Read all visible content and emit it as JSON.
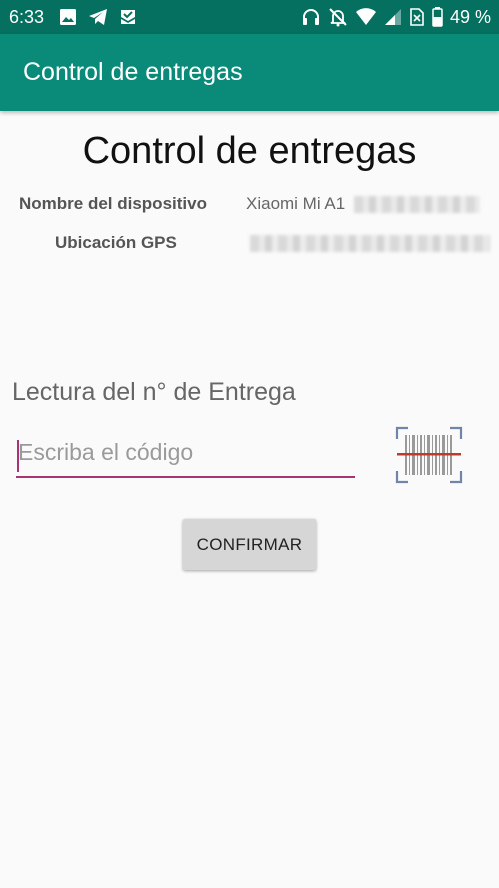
{
  "status_bar": {
    "time": "6:33",
    "battery_percent": "49 %",
    "left_icons": [
      "image-icon",
      "telegram-icon",
      "mail-check-icon"
    ],
    "right_icons": [
      "headphones-icon",
      "bell-off-icon",
      "wifi-icon",
      "cell-signal-icon",
      "no-sim-icon",
      "battery-icon"
    ]
  },
  "app_bar": {
    "title": "Control de entregas"
  },
  "main": {
    "title": "Control de entregas",
    "device_label": "Nombre del dispositivo",
    "device_value": "Xiaomi Mi A1",
    "gps_label": "Ubicación GPS",
    "section_label": "Lectura del n° de Entrega",
    "code_input": {
      "value": "",
      "placeholder": "Escriba el código"
    },
    "scan_icon": "barcode-scanner-icon",
    "confirm_label": "CONFIRMAR"
  },
  "colors": {
    "status_bar": "#05705f",
    "app_bar": "#0a8b79",
    "accent": "#a83373",
    "background": "#fafafa",
    "button": "#d6d6d6"
  }
}
